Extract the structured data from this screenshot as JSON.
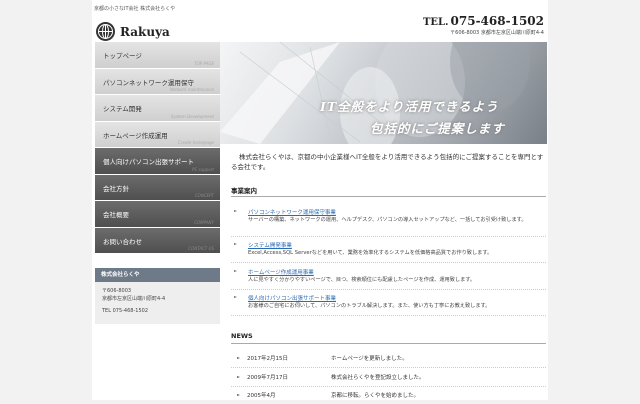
{
  "header": {
    "tagline": "京都の小さなIT会社 株式会社らくや",
    "logo_text": "Rakuya",
    "tel_label": "TEL.",
    "tel_number": "075-468-1502",
    "address": "〒606-8003 京都市左京区山端川原町4-4"
  },
  "nav": [
    {
      "label": "トップページ",
      "sub": "TOP PAGE",
      "active": false
    },
    {
      "label": "パソコンネットワーク運用保守",
      "sub": "Network maintenance",
      "active": false
    },
    {
      "label": "システム開発",
      "sub": "System Development",
      "active": false
    },
    {
      "label": "ホームページ作成運用",
      "sub": "Create homepage",
      "active": false
    },
    {
      "label": "個人向けパソコン出張サポート",
      "sub": "PC support",
      "active": true
    },
    {
      "label": "会社方針",
      "sub": "CONCEPT",
      "active": true
    },
    {
      "label": "会社概要",
      "sub": "COMPANY",
      "active": true
    },
    {
      "label": "お問い合わせ",
      "sub": "CONTACT US",
      "active": true
    }
  ],
  "company_box": {
    "title": "株式会社らくや",
    "postal": "〒606-8003",
    "address": "京都市左京区山端川原町4-4",
    "tel": "TEL 075-468-1502"
  },
  "hero": {
    "line1": "IT全般をより活用できるよう",
    "line2": "包括的にご提案します"
  },
  "intro": "株式会社らくやは、京都の中小企業様へIT全般をより活用できるよう包括的にご提案することを専門とする会社です。",
  "services": {
    "heading": "事業案内",
    "items": [
      {
        "title": "パソコンネットワーク運用保守事業",
        "desc": "サーバーの構築、ネットワークの運用、ヘルプデスク、パソコンの導入セットアップなど、一括してお引受け致します。"
      },
      {
        "title": "システム開発事業",
        "desc": "Excel,Access,SQL Serverなどを用いて、業務を効率化するシステムを低価格高品質でお作り致します。"
      },
      {
        "title": "ホームページ作成運用事業",
        "desc": "人に見やすく分かりやすいページで、目つ、検索順位にも配慮したページを作成、運用致します。"
      },
      {
        "title": "個人向けパソコン出張サポート事業",
        "desc": "お客様のご自宅にお伺いして、パソコンのトラブル解決します。また、使い方も丁寧にお教え致します。"
      }
    ]
  },
  "news": {
    "heading": "NEWS",
    "items": [
      {
        "date": "2017年2月15日",
        "text": "ホームページを更新しました。"
      },
      {
        "date": "2009年7月17日",
        "text": "株式会社らくやを登記設立しました。"
      },
      {
        "date": "2005年4月",
        "text": "京都に移転。らくやを始めました。"
      }
    ]
  },
  "icons": {
    "logo": "globe-icon",
    "list_bullet": "triangle-right-icon"
  },
  "colors": {
    "link": "#2a6bb5",
    "nav_active_bg": "#5a5a5a",
    "company_head_bg": "#6e7a87"
  }
}
